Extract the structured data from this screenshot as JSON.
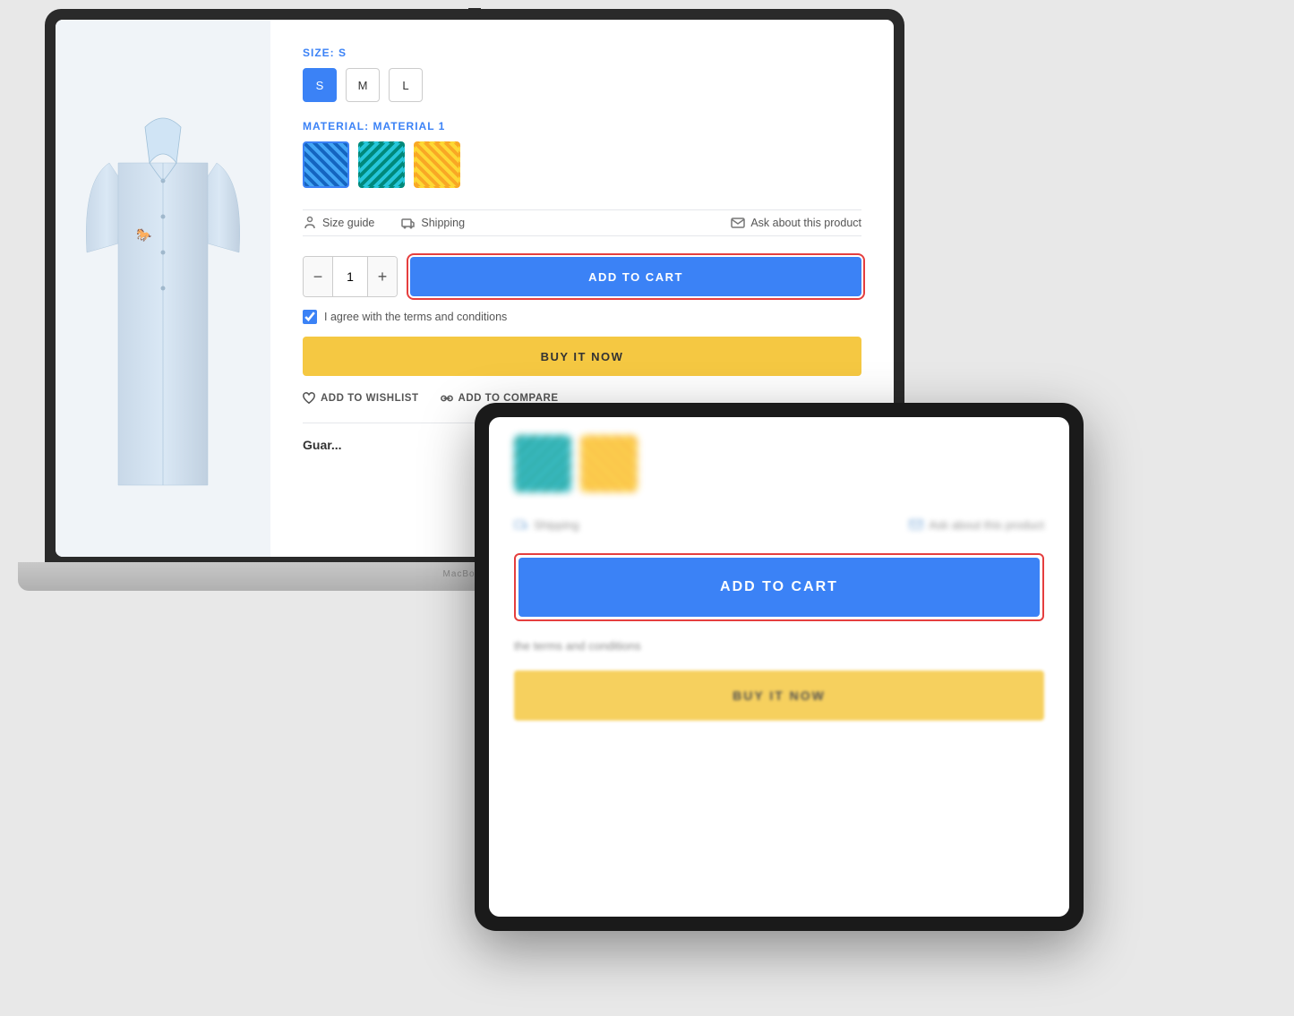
{
  "laptop": {
    "model": "MacBook Pro",
    "size_label": "SIZE:",
    "size_selected": "S",
    "sizes": [
      "S",
      "M",
      "L"
    ],
    "material_label": "MATERIAL:",
    "material_selected": "Material 1",
    "links": {
      "size_guide": "Size guide",
      "shipping": "Shipping",
      "ask_product": "Ask about this product"
    },
    "quantity": "1",
    "add_to_cart": "ADD TO CART",
    "agree_text": "I agree with the terms and conditions",
    "buy_it_now": "BUY IT NOW",
    "add_to_wishlist": "ADD TO WISHLIST",
    "add_to_compare": "ADD TO COMPARE",
    "guarantee": "Guar..."
  },
  "tablet": {
    "shipping": "Shipping",
    "ask_product": "Ask about this product",
    "add_to_cart": "ADD TO CART",
    "agree_text": "the terms and conditions",
    "buy_it_now": "BUY IT NOW"
  }
}
